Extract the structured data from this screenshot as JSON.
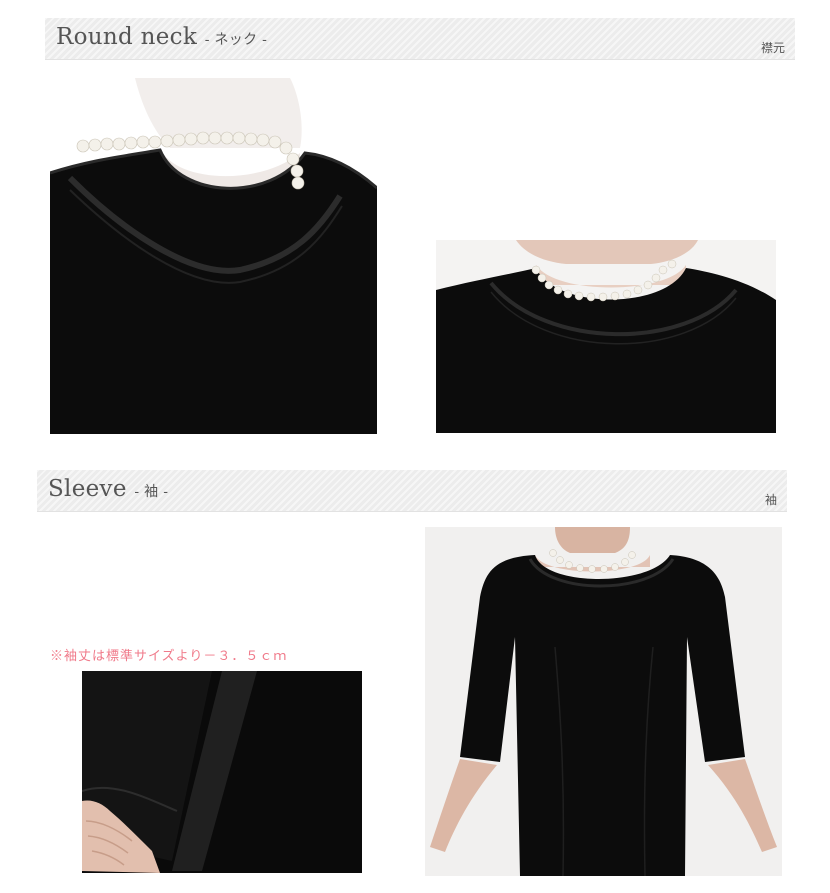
{
  "sections": {
    "neck": {
      "title": "Round neck",
      "sub_title": "- ネック -",
      "right_label": "襟元"
    },
    "sleeve": {
      "title": "Sleeve",
      "sub_title": "- 袖 -",
      "right_label": "袖",
      "note": "※袖丈は標準サイズより－３．５ｃｍ"
    }
  },
  "colors": {
    "header_bg": "#ececec",
    "header_text": "#555555",
    "note_text": "#f07a8a",
    "garment": "#0c0c0c"
  }
}
